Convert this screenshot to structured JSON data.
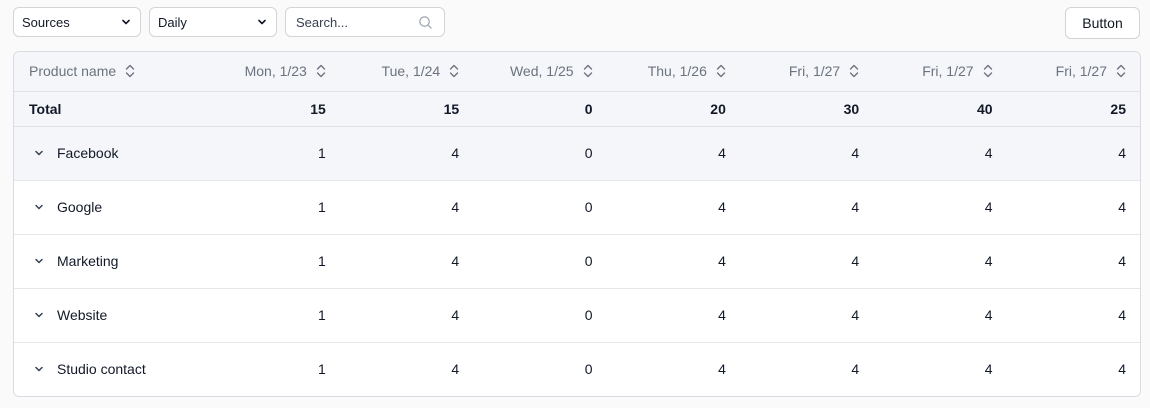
{
  "toolbar": {
    "sources_select": "Sources",
    "period_select": "Daily",
    "search_placeholder": "Search...",
    "button_label": "Button"
  },
  "table": {
    "columns": [
      "Product name",
      "Mon, 1/23",
      "Tue, 1/24",
      "Wed, 1/25",
      "Thu, 1/26",
      "Fri, 1/27",
      "Fri, 1/27",
      "Fri, 1/27"
    ],
    "total": {
      "label": "Total",
      "values": [
        "15",
        "15",
        "0",
        "20",
        "30",
        "40",
        "25"
      ]
    },
    "rows": [
      {
        "name": "Facebook",
        "values": [
          "1",
          "4",
          "0",
          "4",
          "4",
          "4",
          "4"
        ]
      },
      {
        "name": "Google",
        "values": [
          "1",
          "4",
          "0",
          "4",
          "4",
          "4",
          "4"
        ]
      },
      {
        "name": "Marketing",
        "values": [
          "1",
          "4",
          "0",
          "4",
          "4",
          "4",
          "4"
        ]
      },
      {
        "name": "Website",
        "values": [
          "1",
          "4",
          "0",
          "4",
          "4",
          "4",
          "4"
        ]
      },
      {
        "name": "Studio contact",
        "values": [
          "1",
          "4",
          "0",
          "4",
          "4",
          "4",
          "4"
        ]
      }
    ]
  },
  "icons": {
    "select_chevron": "chevron-down-icon",
    "search": "search-icon",
    "sort": "sort-icon",
    "expand": "chevron-down-icon"
  }
}
